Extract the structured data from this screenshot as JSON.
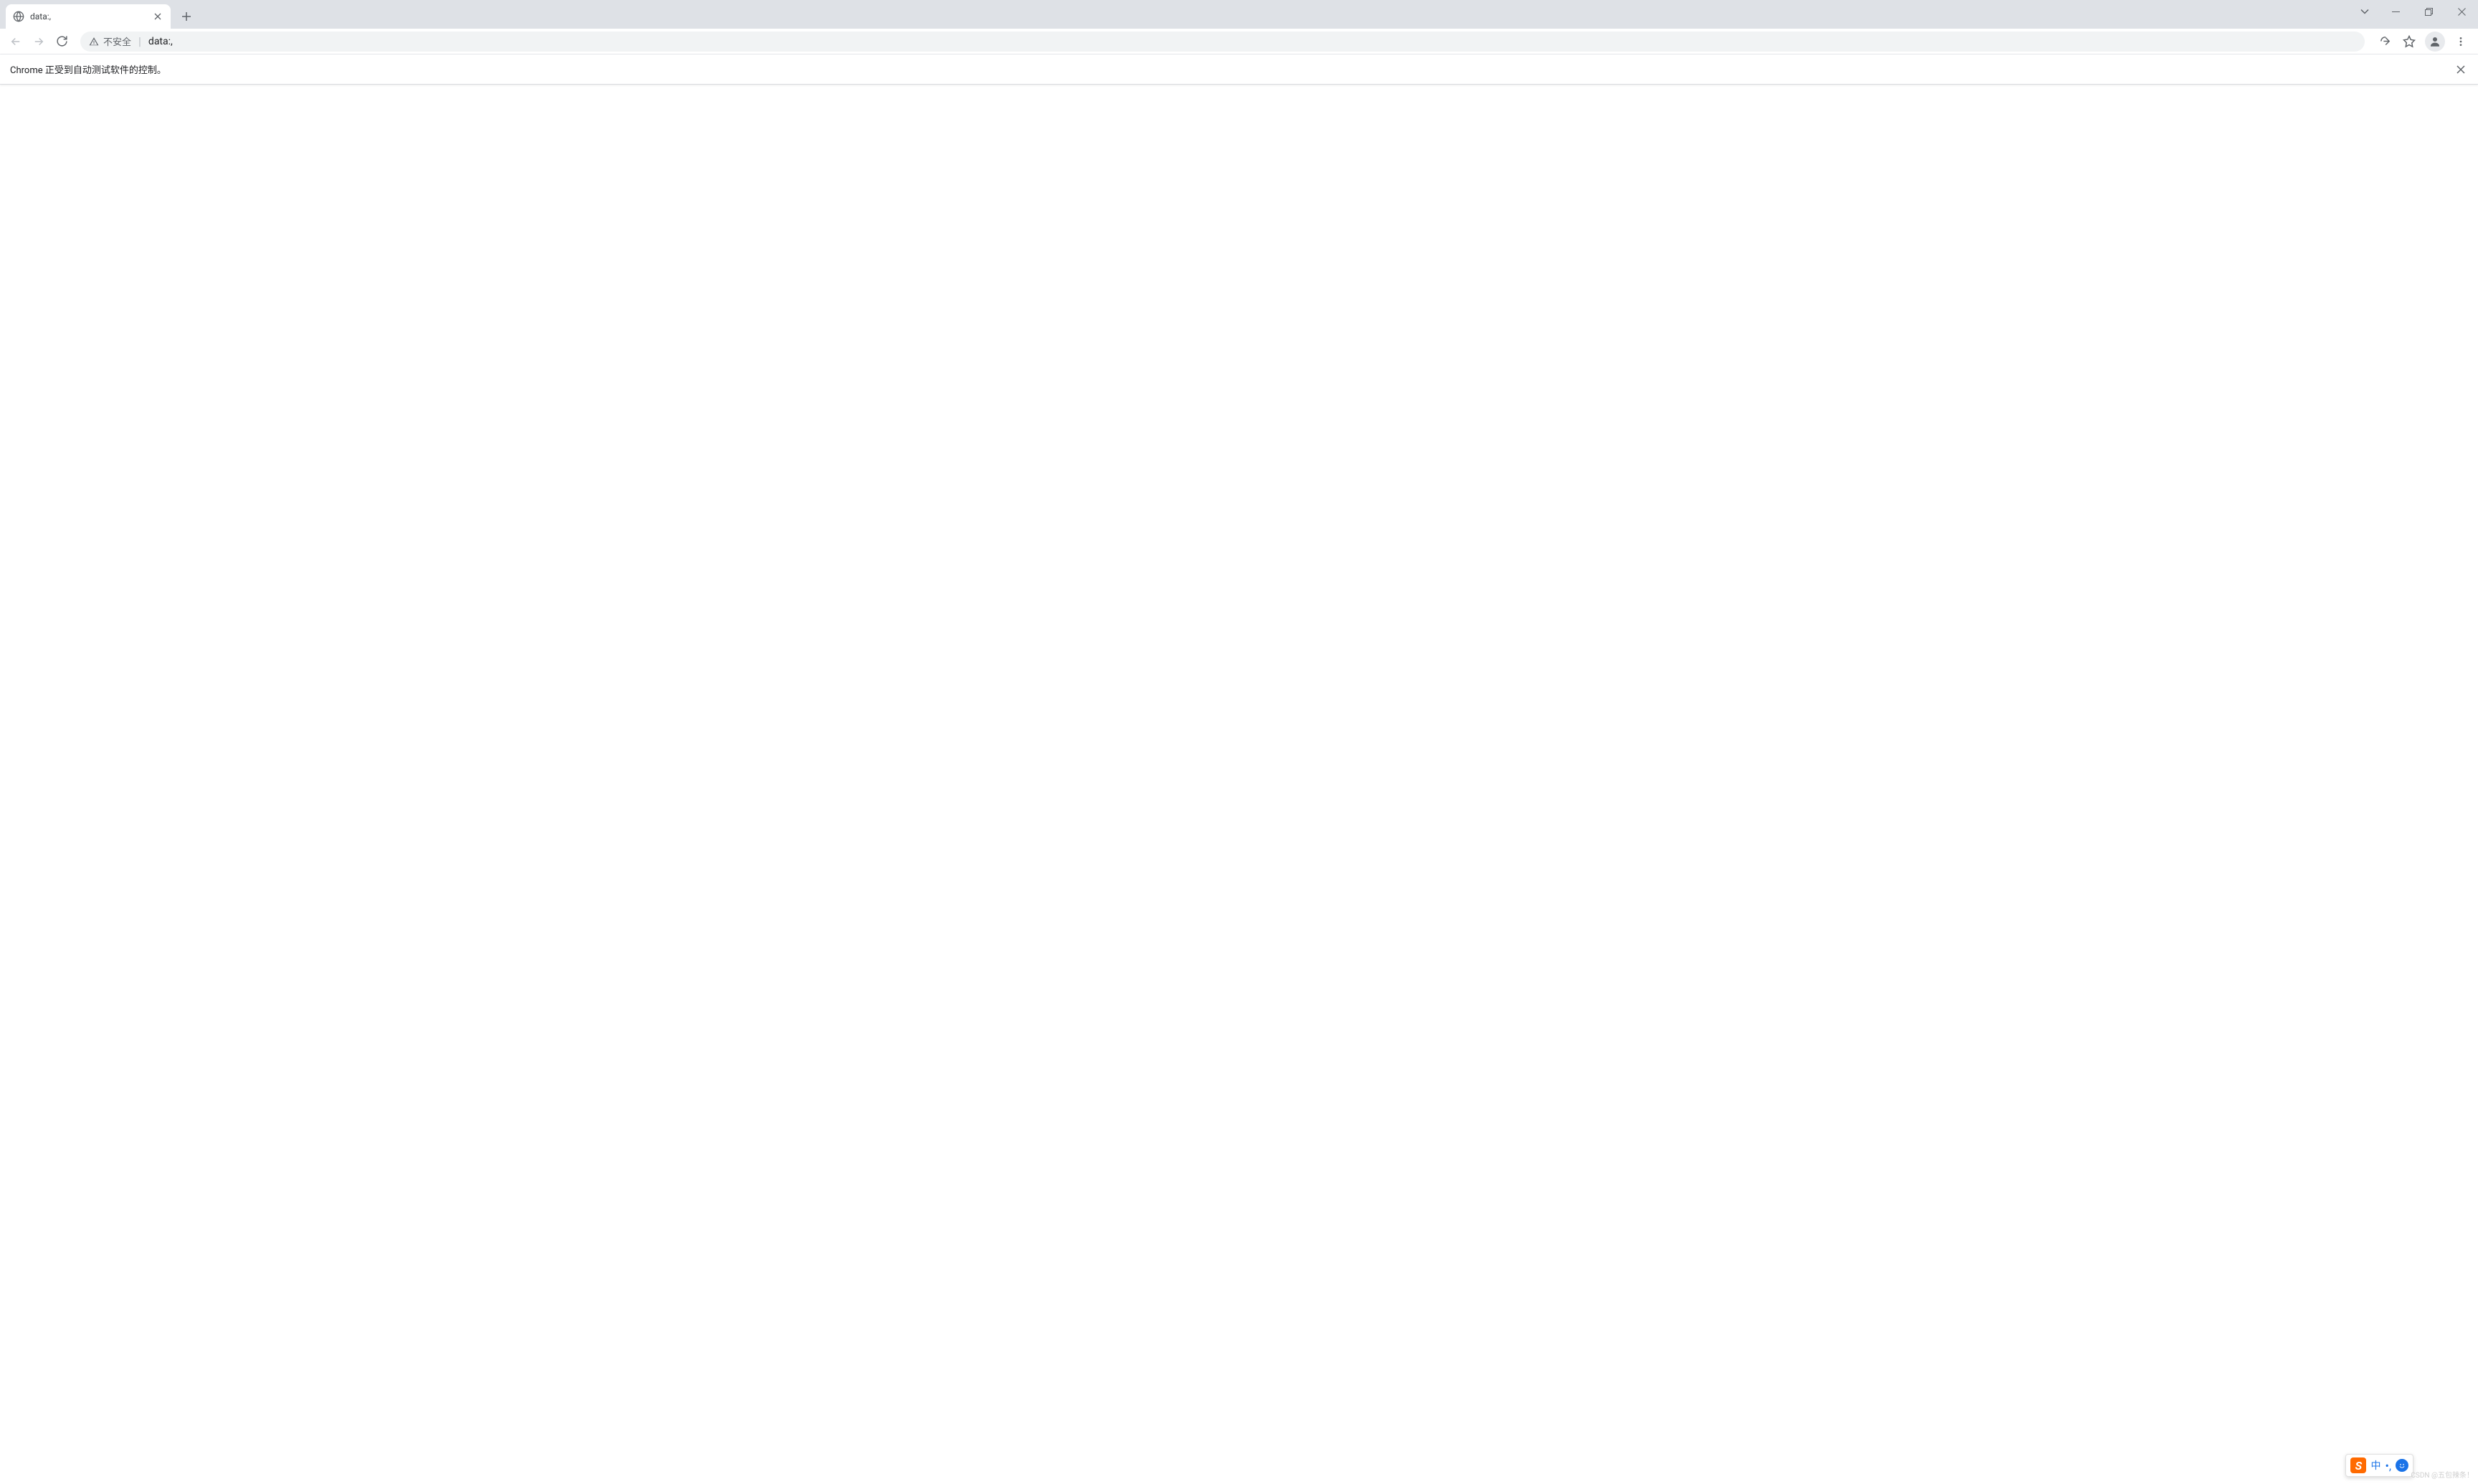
{
  "tab": {
    "title": "data:,"
  },
  "addressBar": {
    "securityLabel": "不安全",
    "url": "data:,"
  },
  "infoBar": {
    "message": "Chrome 正受到自动测试软件的控制。"
  },
  "ime": {
    "logo": "S",
    "lang": "中",
    "punct": "•,"
  },
  "watermark": "CSDN @五包辣条！"
}
